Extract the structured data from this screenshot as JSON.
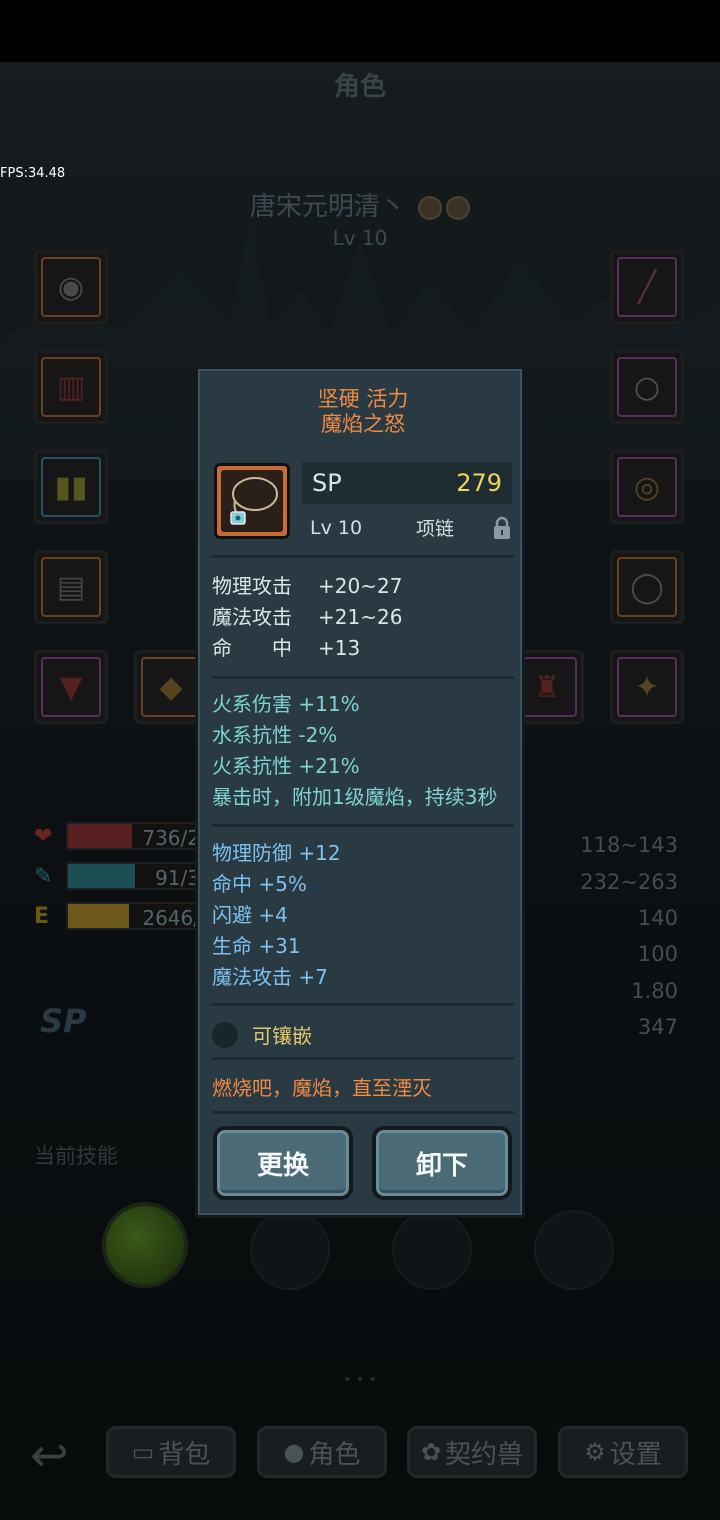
{
  "header": {
    "title": "角色",
    "fps": "FPS:34.48"
  },
  "character": {
    "name": "唐宋元明清丶",
    "level": "Lv 10"
  },
  "equipment_slots_left": [
    "hood-icon",
    "armor-icon",
    "boots-icon",
    "bracer-icon",
    "cape-icon",
    "shoulder-icon"
  ],
  "equipment_slots_right": [
    "weapon-icon",
    "ring-icon",
    "bracelet-icon",
    "necklace-icon",
    "trophy-icon",
    "shield-icon"
  ],
  "stats_left": [
    {
      "icon": "heart-icon",
      "text": "736/2",
      "color": "#a03030",
      "fill": 0.47
    },
    {
      "icon": "mana-icon",
      "text": "91/3",
      "color": "#2a8a9a",
      "fill": 0.49
    },
    {
      "icon": "exp-icon",
      "label": "E",
      "text": "2646/",
      "color": "#c8a020",
      "fill": 0.45
    }
  ],
  "stats_right": [
    "118~143",
    "232~263",
    "140",
    "100",
    "1.80",
    "347"
  ],
  "sp_label": "SP",
  "skills": {
    "title": "当前技能"
  },
  "nav": {
    "back": "back-arrow-icon",
    "items": [
      {
        "label": "背包",
        "icon": "bag-icon"
      },
      {
        "label": "角色",
        "icon": "character-icon"
      },
      {
        "label": "契约兽",
        "icon": "paw-icon"
      },
      {
        "label": "设置",
        "icon": "gear-icon"
      }
    ]
  },
  "popup": {
    "title_line1": "坚硬 活力",
    "title_line2": "魔焰之怒",
    "sp_key": "SP",
    "sp_value": "279",
    "level": "Lv 10",
    "slot_type": "项链",
    "base_stats": [
      {
        "label": "物理攻击",
        "value": "+20~27"
      },
      {
        "label": "魔法攻击",
        "value": "+21~26"
      },
      {
        "label": "命　　中",
        "value": "+13"
      }
    ],
    "special_stats": [
      "火系伤害 +11%",
      "水系抗性 -2%",
      "火系抗性 +21%",
      "暴击时，附加1级魔焰，持续3秒"
    ],
    "bonus_stats": [
      "物理防御 +12",
      "命中 +5%",
      "闪避 +4",
      "生命 +31",
      "魔法攻击 +7"
    ],
    "socket": "可镶嵌",
    "flavor": "燃烧吧，魔焰，直至湮灭",
    "btn_replace": "更换",
    "btn_unequip": "卸下",
    "colors": {
      "title": "#ef8a44",
      "sp_value": "#eed659",
      "special": "#7fd3d3",
      "bonus": "#7ec0ee",
      "socket": "#e3c96c"
    }
  }
}
